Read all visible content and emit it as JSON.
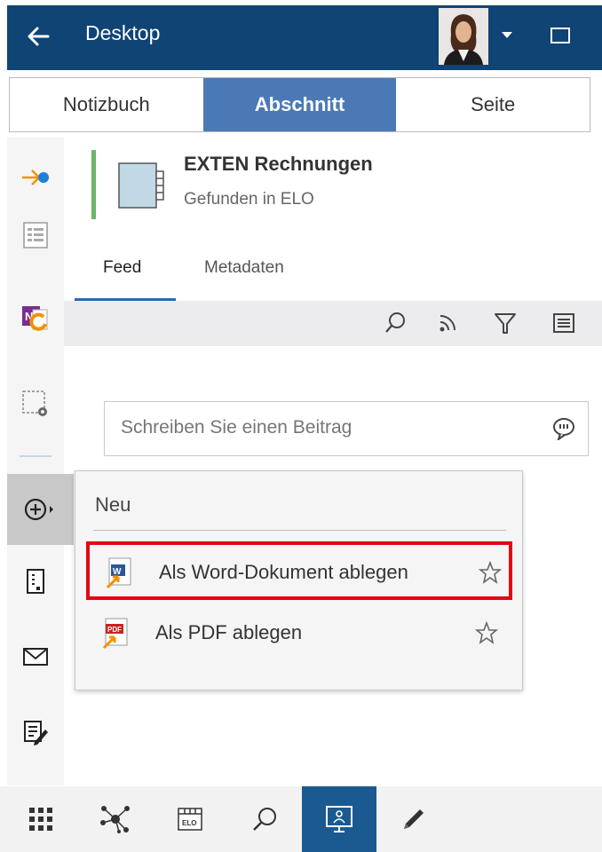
{
  "header": {
    "title": "Desktop",
    "icons": [
      "back-arrow-icon",
      "user-avatar",
      "dropdown-caret-icon",
      "window-icon"
    ]
  },
  "tabs": [
    {
      "label": "Notizbuch",
      "active": false
    },
    {
      "label": "Abschnitt",
      "active": true
    },
    {
      "label": "Seite",
      "active": false
    }
  ],
  "sidebar": {
    "items": [
      "arrow-dot-icon",
      "list-icon",
      "onenote-refresh-icon",
      "selection-gear-icon",
      "add-circle-icon",
      "document-icon",
      "mail-icon",
      "edit-note-icon"
    ],
    "selected": "add-circle-icon"
  },
  "entry": {
    "title": "EXTEN Rechnungen",
    "subtitle": "Gefunden in ELO",
    "accent_color": "#6cb56b"
  },
  "subtabs": [
    {
      "label": "Feed",
      "active": true
    },
    {
      "label": "Metadaten",
      "active": false
    }
  ],
  "feed_toolbar": [
    "search-icon",
    "rss-icon",
    "filter-icon",
    "list-view-icon"
  ],
  "post": {
    "placeholder": "Schreiben Sie einen Beitrag"
  },
  "popup": {
    "heading": "Neu",
    "items": [
      {
        "label": "Als Word-Dokument ablegen",
        "icon": "word-document-icon",
        "highlighted": true
      },
      {
        "label": "Als PDF ablegen",
        "icon": "pdf-document-icon",
        "highlighted": false
      }
    ]
  },
  "bottom_nav": {
    "items": [
      "apps-grid-icon",
      "network-icon",
      "elo-archive-icon",
      "search-icon",
      "desktop-icon",
      "pen-icon"
    ],
    "active": "desktop-icon"
  },
  "colors": {
    "header_bg": "#0f4475",
    "active_tab": "#4b79b6",
    "highlight_border": "#e30613",
    "active_nav": "#1b5a90"
  }
}
